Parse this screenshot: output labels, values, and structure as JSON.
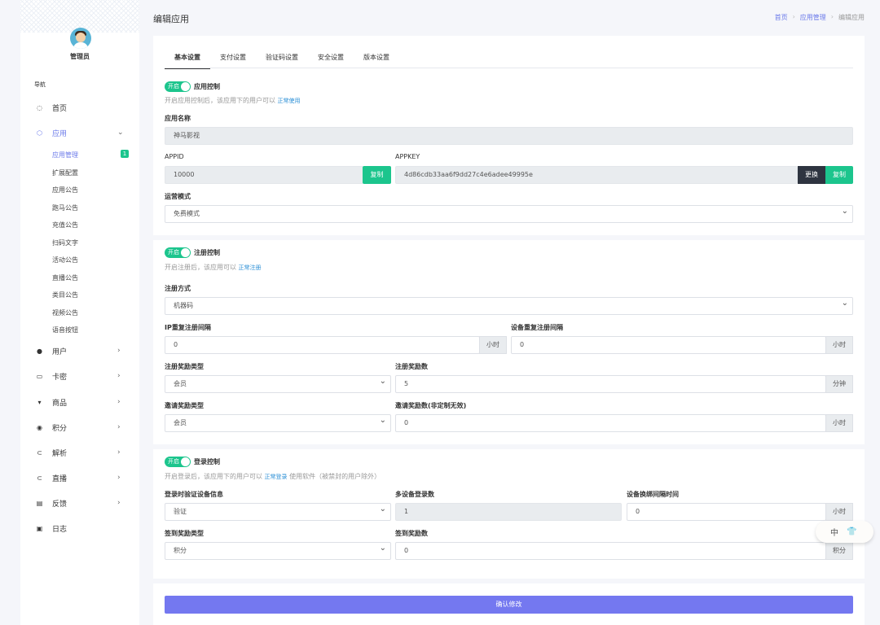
{
  "sidebar": {
    "admin_name": "管理员",
    "nav_title": "导航",
    "items": [
      {
        "label": "首页",
        "icon": "circle-icon"
      },
      {
        "label": "应用",
        "icon": "cube-icon"
      },
      {
        "label": "用户",
        "icon": "user-icon"
      },
      {
        "label": "卡密",
        "icon": "card-icon"
      },
      {
        "label": "商品",
        "icon": "cart-icon"
      },
      {
        "label": "积分",
        "icon": "coin-icon"
      },
      {
        "label": "解析",
        "icon": "link-icon"
      },
      {
        "label": "直播",
        "icon": "live-icon"
      },
      {
        "label": "反馈",
        "icon": "feedback-icon"
      },
      {
        "label": "日志",
        "icon": "log-icon"
      }
    ],
    "sub_items": [
      "应用管理",
      "扩展配置",
      "应用公告",
      "跑马公告",
      "充值公告",
      "扫码文字",
      "活动公告",
      "直播公告",
      "类目公告",
      "视频公告",
      "语音按钮"
    ],
    "badge": "1"
  },
  "header": {
    "title": "编辑应用",
    "breadcrumb": [
      "首页",
      "应用管理",
      "编辑应用"
    ]
  },
  "tabs": [
    "基本设置",
    "支付设置",
    "验证码设置",
    "安全设置",
    "版本设置"
  ],
  "app_section": {
    "toggle_text": "开启",
    "toggle_label": "应用控制",
    "hint": "开启应用控制后，该应用下的用户可以",
    "hint_link": "正常使用",
    "name_label": "应用名称",
    "name_value": "神马影视",
    "appid_label": "APPID",
    "appid_value": "10000",
    "copy_label": "复制",
    "appkey_label": "APPKEY",
    "appkey_value": "4d86cdb33aa6f9dd27c4e6adee49995e",
    "change_label": "更换",
    "mode_label": "运营模式",
    "mode_value": "免费模式"
  },
  "register_section": {
    "toggle_text": "开启",
    "toggle_label": "注册控制",
    "hint": "开启注册后，该应用可以",
    "hint_link": "正常注册",
    "method_label": "注册方式",
    "method_value": "机器码",
    "ip_interval_label": "IP重复注册间隔",
    "ip_interval_value": "0",
    "device_interval_label": "设备重复注册间隔",
    "device_interval_value": "0",
    "hour_unit": "小时",
    "reward_type_label": "注册奖励类型",
    "reward_type_value": "会员",
    "reward_num_label": "注册奖励数",
    "reward_num_value": "5",
    "minute_unit": "分钟",
    "invite_type_label": "邀请奖励类型",
    "invite_type_value": "会员",
    "invite_num_label": "邀请奖励数(非定制无效)",
    "invite_num_value": "0"
  },
  "login_section": {
    "toggle_text": "开启",
    "toggle_label": "登录控制",
    "hint": "开启登录后，该应用下的用户可以",
    "hint_link": "正常登录",
    "hint_tail": "使用软件（被禁封的用户除外）",
    "verify_label": "登录时验证设备信息",
    "verify_value": "验证",
    "multi_label": "多设备登录数",
    "multi_value": "1",
    "rebind_label": "设备换绑间隔时间",
    "rebind_value": "0",
    "hour_unit": "小时",
    "sign_type_label": "签到奖励类型",
    "sign_type_value": "积分",
    "sign_num_label": "签到奖励数",
    "sign_num_value": "0",
    "points_unit": "积分"
  },
  "submit_label": "确认修改",
  "ime": {
    "text": "中",
    "icon": "shirt-icon"
  }
}
